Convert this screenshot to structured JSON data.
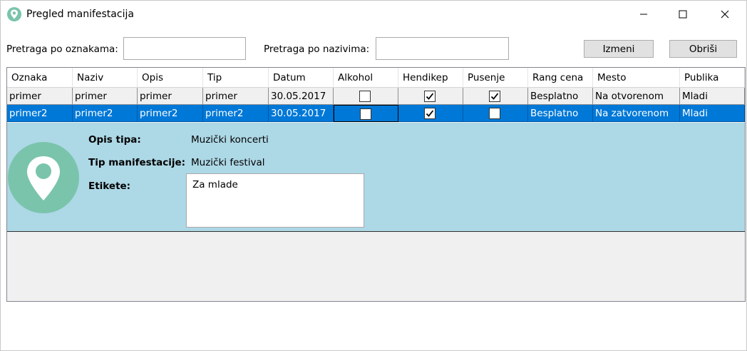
{
  "window": {
    "title": "Pregled manifestacija"
  },
  "search": {
    "by_tags_label": "Pretraga po oznakama:",
    "by_tags_value": "",
    "by_names_label": "Pretraga po nazivima:",
    "by_names_value": ""
  },
  "toolbar": {
    "edit_label": "Izmeni",
    "delete_label": "Obriši"
  },
  "table": {
    "columns": [
      "Oznaka",
      "Naziv",
      "Opis",
      "Tip",
      "Datum",
      "Alkohol",
      "Hendikep",
      "Pusenje",
      "Rang cena",
      "Mesto",
      "Publika"
    ],
    "rows": [
      {
        "oznaka": "primer",
        "naziv": "primer",
        "opis": "primer",
        "tip": "primer",
        "datum": "30.05.2017",
        "alkohol": false,
        "hendikep": true,
        "pusenje": true,
        "rang_cena": "Besplatno",
        "mesto": "Na otvorenom",
        "publika": "Mladi"
      },
      {
        "oznaka": "primer2",
        "naziv": "primer2",
        "opis": "primer2",
        "tip": "primer2",
        "datum": "30.05.2017",
        "alkohol": false,
        "hendikep": true,
        "pusenje": false,
        "rang_cena": "Besplatno",
        "mesto": "Na zatvorenom",
        "publika": "Mladi"
      }
    ],
    "selected_row": 1
  },
  "details": {
    "opis_tipa_label": "Opis tipa:",
    "opis_tipa_value": "Muzički koncerti",
    "tip_label": "Tip manifestacije:",
    "tip_value": "Muzički festival",
    "etikete_label": "Etikete:",
    "etikete_value": "Za mlade",
    "icon": "location-pin-icon"
  },
  "colors": {
    "selection": "#0078d7",
    "details_bg": "#add8e6",
    "pin_bg": "#7ac4ac"
  }
}
